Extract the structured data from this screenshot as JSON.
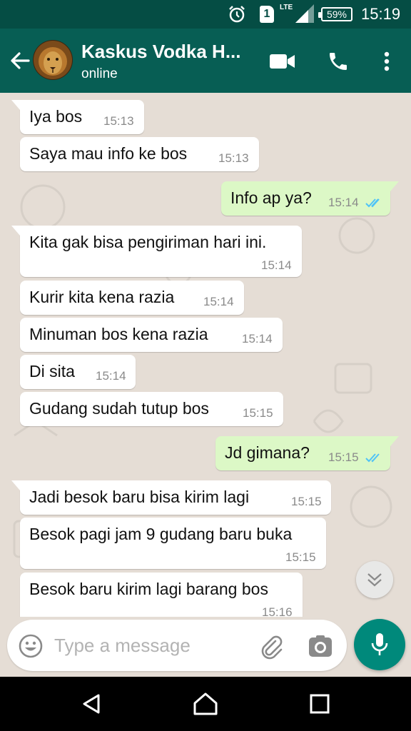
{
  "status_bar": {
    "sim_slot": "1",
    "network": "LTE",
    "battery": "59%",
    "time": "15:19",
    "icons": [
      "alarm-icon",
      "sim-icon",
      "signal-icon",
      "battery-icon"
    ]
  },
  "header": {
    "title": "Kaskus Vodka H...",
    "status": "online",
    "icons": [
      "back-arrow-icon",
      "avatar-lion",
      "video-call-icon",
      "phone-icon",
      "more-vert-icon"
    ]
  },
  "messages": [
    {
      "direction": "in",
      "text": "Iya bos",
      "time": "15:13"
    },
    {
      "direction": "in",
      "text": "Saya mau info ke bos",
      "time": "15:13"
    },
    {
      "direction": "out",
      "text": "Info ap ya?",
      "time": "15:14",
      "read": true
    },
    {
      "direction": "in",
      "text": "Kita gak bisa pengiriman hari ini.",
      "time": "15:14"
    },
    {
      "direction": "in",
      "text": "Kurir kita kena razia",
      "time": "15:14"
    },
    {
      "direction": "in",
      "text": "Minuman bos kena razia",
      "time": "15:14"
    },
    {
      "direction": "in",
      "text": "Di sita",
      "time": "15:14"
    },
    {
      "direction": "in",
      "text": "Gudang sudah tutup bos",
      "time": "15:15"
    },
    {
      "direction": "out",
      "text": "Jd gimana?",
      "time": "15:15",
      "read": true
    },
    {
      "direction": "in",
      "text": "Jadi besok baru bisa kirim lagi",
      "time": "15:15"
    },
    {
      "direction": "in",
      "text": "Besok pagi jam 9 gudang baru buka",
      "time": "15:15"
    },
    {
      "direction": "in",
      "text": "Besok baru kirim lagi barang bos",
      "time": "15:16"
    }
  ],
  "composer": {
    "placeholder": "Type a message",
    "icons": [
      "emoji-icon",
      "attach-icon",
      "camera-icon",
      "mic-icon",
      "scroll-down-icon"
    ]
  },
  "colors": {
    "status_bar": "#054d44",
    "app_bar": "#075e54",
    "chat_background": "#e5ddd5",
    "incoming_bubble": "#ffffff",
    "outgoing_bubble": "#dcf8c6",
    "read_ticks": "#4fc3f7",
    "mic_button": "#00897b"
  },
  "nav_bar": {
    "icons": [
      "nav-back-icon",
      "nav-home-icon",
      "nav-recent-icon"
    ]
  }
}
